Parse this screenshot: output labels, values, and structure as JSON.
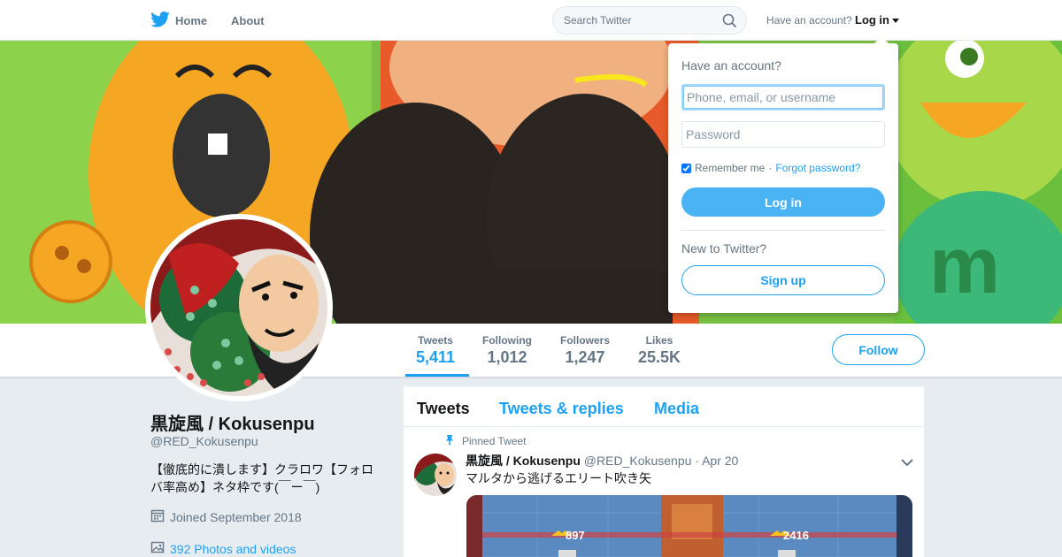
{
  "nav": {
    "home_label": "Home",
    "about_label": "About",
    "search_placeholder": "Search Twitter",
    "have_account_text": "Have an account?",
    "login_label": "Log in"
  },
  "profile": {
    "name": "黒旋風 / Kokusenpu",
    "handle": "@RED_Kokusenpu",
    "bio": "【徹底的に潰します】クラロワ【フォロバ率高め】ネタ枠です(￣ー￣)",
    "joined": "Joined September 2018",
    "photos": "392 Photos and videos",
    "follow_label": "Follow"
  },
  "stats": [
    {
      "label": "Tweets",
      "value": "5,411"
    },
    {
      "label": "Following",
      "value": "1,012"
    },
    {
      "label": "Followers",
      "value": "1,247"
    },
    {
      "label": "Likes",
      "value": "25.5K"
    }
  ],
  "timeline": {
    "tabs": [
      "Tweets",
      "Tweets & replies",
      "Media"
    ],
    "pinned_label": "Pinned Tweet",
    "tweet": {
      "name": "黒旋風 / Kokusenpu",
      "handle": "@RED_Kokusenpu",
      "date": "· Apr 20",
      "text": "マルタから逃げるエリート吹き矢",
      "media_numbers": [
        "897",
        "2416"
      ]
    }
  },
  "login_dropdown": {
    "title": "Have an account?",
    "username_placeholder": "Phone, email, or username",
    "password_placeholder": "Password",
    "remember_label": "Remember me",
    "separator": "·",
    "forgot_label": "Forgot password?",
    "login_button": "Log in",
    "new_text": "New to Twitter?",
    "signup_button": "Sign up"
  },
  "colors": {
    "accent": "#1da1f2",
    "login_button": "#4ab3f4",
    "background": "#e6ecf0"
  }
}
